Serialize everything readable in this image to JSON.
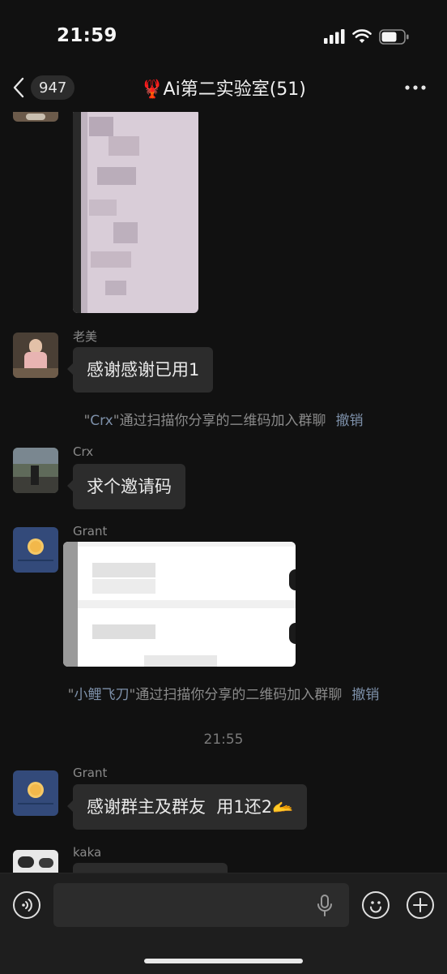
{
  "status_bar": {
    "time": "21:59"
  },
  "nav": {
    "back_badge": "947",
    "title_emoji": "🦞",
    "title": "Ai第二实验室(51)"
  },
  "messages": [
    {
      "sender": "老美",
      "text": "感谢感谢已用1"
    },
    {
      "type": "system",
      "quote_open": "\"",
      "name": "Crx",
      "quote_close": "\"",
      "text": "通过扫描你分享的二维码加入群聊",
      "action": "撤销"
    },
    {
      "sender": "Crx",
      "text": "求个邀请码"
    },
    {
      "sender": "Grant",
      "content": "image"
    },
    {
      "type": "system",
      "quote_open": "\"",
      "name": "小鲤飞刀",
      "quote_close": "\"",
      "text": "通过扫描你分享的二维码加入群聊",
      "action": "撤销"
    },
    {
      "type": "time",
      "text": "21:55"
    },
    {
      "sender": "Grant",
      "text": "感谢群主及群友  用1还2",
      "emoji": "🫴"
    },
    {
      "sender": "kaka",
      "text": ""
    }
  ],
  "input": {
    "placeholder": "",
    "value": ""
  },
  "colors": {
    "background": "#111111",
    "bubble": "#2c2c2c",
    "link": "#7d90a9",
    "input_bar": "#1e1e1e"
  },
  "icons": [
    "signal-icon",
    "wifi-icon",
    "battery-icon",
    "back-chevron-icon",
    "more-icon",
    "voice-icon",
    "mic-icon",
    "emoji-icon",
    "plus-icon"
  ]
}
